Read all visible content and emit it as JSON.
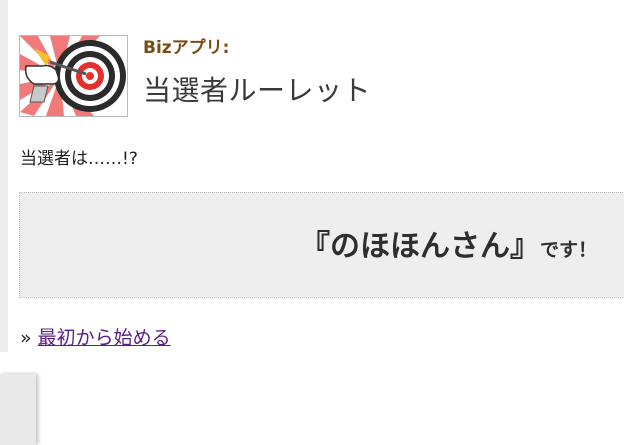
{
  "header": {
    "category": "Bizアプリ:",
    "title": "当選者ルーレット",
    "icon": "dartboard-hand-icon"
  },
  "question": "当選者は……!?",
  "result": {
    "name": "『のほほんさん』",
    "suffix": "です！"
  },
  "restart": {
    "prefix": "»",
    "link_label": "最初から始める"
  },
  "colors": {
    "category": "#7a4b12",
    "link": "#5a1f8a",
    "result_bg": "#eeeeee",
    "icon_red": "#e5302d"
  }
}
